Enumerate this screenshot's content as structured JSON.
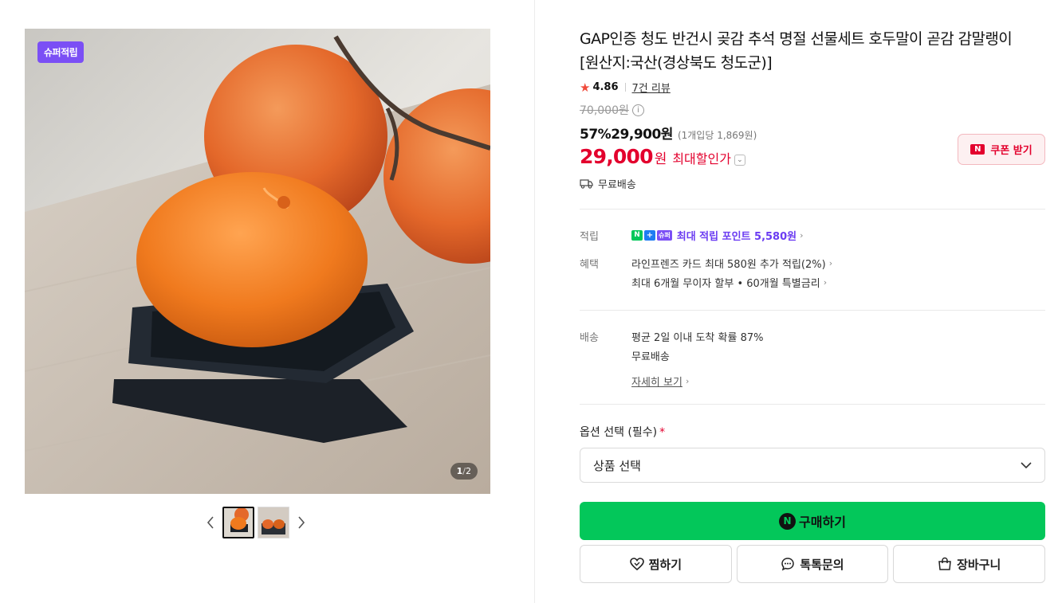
{
  "gallery": {
    "badge": "슈퍼적립",
    "page_current": "1",
    "page_sep": "/",
    "page_total": "2"
  },
  "product": {
    "title": "GAP인증 청도 반건시 곶감 추석 명절 선물세트 호두말이 곧감 감말랭이 [원산지:국산(경상북도 청도군)]",
    "rating": "4.86",
    "reviews": "7건 리뷰",
    "original_price": "70,000원",
    "discount_pct": "57%",
    "sale_price": "29,900원",
    "unit_price": "(1개입당 1,869원)",
    "max_price": "29,000",
    "max_won": "원",
    "max_label": "최대할인가",
    "shipping": "무료배송"
  },
  "coupon": {
    "badge": "N",
    "label": "쿠폰 받기"
  },
  "benefits": {
    "points_label": "적립",
    "points_badges": [
      "N",
      "+",
      "슈퍼"
    ],
    "points_text": "최대 적립 포인트 5,580원",
    "benefit_label": "혜택",
    "benefit_lines": [
      "라인프렌즈 카드 최대 580원 추가 적립(2%)",
      "최대 6개월 무이자 할부 • 60개월 특별금리"
    ]
  },
  "delivery": {
    "label": "배송",
    "lines": [
      "평균 2일 이내 도착 확률 87%",
      "무료배송"
    ],
    "detail_link": "자세히 보기"
  },
  "options": {
    "label": "옵션 선택 (필수)",
    "required_mark": "*",
    "select_value": "상품 선택"
  },
  "actions": {
    "buy_icon": "N",
    "buy": "구매하기",
    "wish": "찜하기",
    "talk": "톡톡문의",
    "cart": "장바구니"
  },
  "colors": {
    "accent_green": "#03c75a",
    "price_red": "#e3002d",
    "super_purple": "#7b4ff5"
  }
}
